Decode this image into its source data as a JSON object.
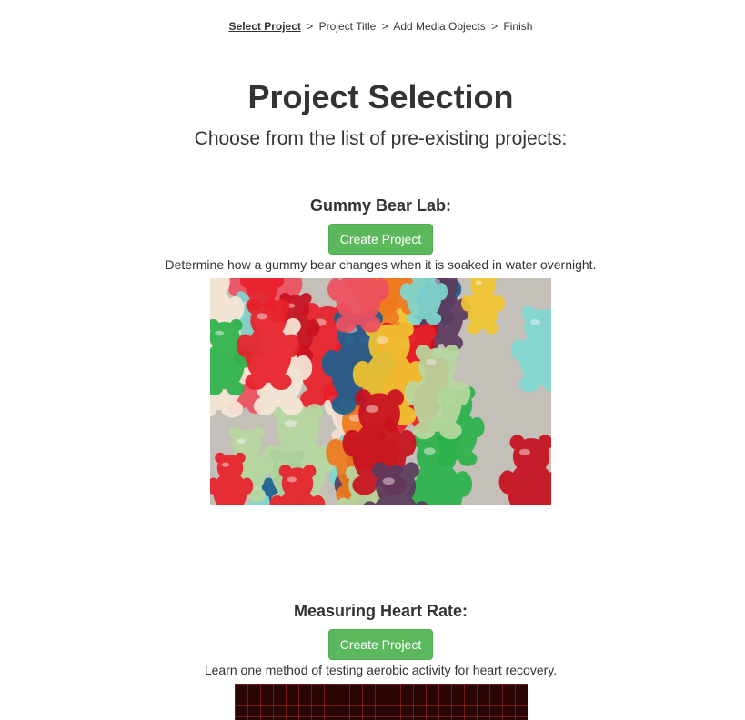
{
  "breadcrumb": {
    "steps": [
      "Select Project",
      "Project Title",
      "Add Media Objects",
      "Finish"
    ],
    "separator": ">"
  },
  "header": {
    "title": "Project Selection",
    "subtitle": "Choose from the list of pre-existing projects:"
  },
  "projects": [
    {
      "name": "Gummy Bear Lab:",
      "button_label": "Create Project",
      "description": "Determine how a gummy bear changes when it is soaked in water overnight."
    },
    {
      "name": "Measuring Heart Rate:",
      "button_label": "Create Project",
      "description": "Learn one method of testing aerobic activity for heart recovery."
    }
  ],
  "colors": {
    "button_bg": "#5cb85c",
    "text": "#333333"
  }
}
